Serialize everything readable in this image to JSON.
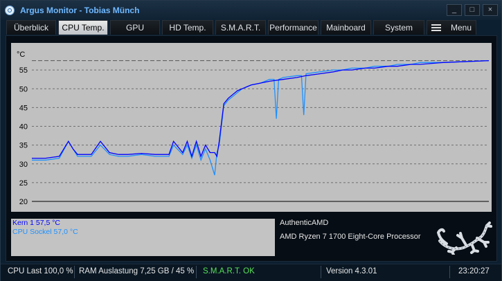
{
  "window": {
    "title": "Argus Monitor - Tobias Münch",
    "minimize": "_",
    "maximize": "□",
    "close": "×"
  },
  "tabs": [
    {
      "label": "Überblick"
    },
    {
      "label": "CPU Temp."
    },
    {
      "label": "GPU"
    },
    {
      "label": "HD Temp."
    },
    {
      "label": "S.M.A.R.T."
    },
    {
      "label": "Performance"
    },
    {
      "label": "Mainboard"
    },
    {
      "label": "System"
    },
    {
      "label": "Menu"
    }
  ],
  "active_tab": "CPU Temp.",
  "chart_data": {
    "type": "line",
    "ylabel": "°C",
    "ylim": [
      20,
      60
    ],
    "yticks": [
      20,
      25,
      30,
      35,
      40,
      45,
      50,
      55
    ],
    "dashed_reference": 57.5,
    "grid": true,
    "series": [
      {
        "name": "Kern 1",
        "color": "#0000ff",
        "x": [
          0,
          3,
          6,
          8,
          9,
          10,
          12,
          13,
          15,
          17,
          19,
          21,
          24,
          27,
          30,
          31,
          33,
          34,
          35,
          36,
          37,
          38,
          39,
          40,
          40.5,
          41,
          42,
          43,
          44,
          45,
          46,
          47,
          48,
          50,
          52,
          55,
          58,
          60,
          63,
          66,
          68,
          70,
          73,
          75,
          78,
          80,
          83,
          85,
          90,
          100
        ],
        "values": [
          31.5,
          31.5,
          32,
          36,
          34,
          32.5,
          32.5,
          32.5,
          36,
          33,
          32.5,
          32.5,
          32.8,
          32.5,
          32.5,
          36,
          33,
          36,
          32,
          36,
          32,
          35,
          33,
          33,
          32,
          36,
          46,
          47.5,
          48.5,
          49.5,
          50,
          50.5,
          51,
          51.5,
          52,
          52.5,
          53,
          53.5,
          54,
          54.5,
          55,
          55,
          55.5,
          55.5,
          56,
          56,
          56.5,
          56.5,
          57,
          57.5
        ]
      },
      {
        "name": "CPU Sockel",
        "color": "#1e90ff",
        "x": [
          0,
          3,
          6,
          8,
          9,
          10,
          12,
          13,
          15,
          17,
          19,
          21,
          24,
          27,
          30,
          31,
          33,
          34,
          35,
          36,
          37,
          38,
          39,
          40,
          40.5,
          41,
          42,
          43,
          44,
          45,
          46,
          47,
          48,
          50,
          52,
          53,
          53.5,
          54,
          55,
          58,
          59,
          59.5,
          60,
          63,
          66,
          68,
          70,
          73,
          75,
          78,
          80,
          83,
          85,
          90,
          100
        ],
        "values": [
          31,
          31,
          31.5,
          36,
          34,
          32,
          32,
          32,
          35,
          32.5,
          32,
          32,
          32.5,
          32,
          32,
          35,
          32.5,
          35,
          31.5,
          35,
          31,
          34,
          31,
          27,
          33,
          35,
          45.5,
          47,
          48,
          49,
          50,
          50.5,
          51,
          51.5,
          52.5,
          52.5,
          42,
          52.5,
          53,
          53.5,
          53.5,
          43,
          54,
          54.5,
          55,
          55,
          55.5,
          55.5,
          56,
          56,
          56.5,
          56.5,
          57,
          57,
          57.5
        ]
      }
    ]
  },
  "legend": [
    {
      "text": "Kern 1 57,5 °C",
      "color": "#0000ff"
    },
    {
      "text": "CPU Sockel 57,0 °C",
      "color": "#1e90ff"
    }
  ],
  "cpu_info": {
    "vendor": "AuthenticAMD",
    "model": "AMD Ryzen 7 1700 Eight-Core Processor"
  },
  "statusbar": {
    "cpu_last": "CPU Last 100,0 %",
    "ram": "RAM Auslastung 7,25 GB / 45 %",
    "smart": "S.M.A.R.T. OK",
    "version": "Version 4.3.01",
    "time": "23:20:27"
  }
}
